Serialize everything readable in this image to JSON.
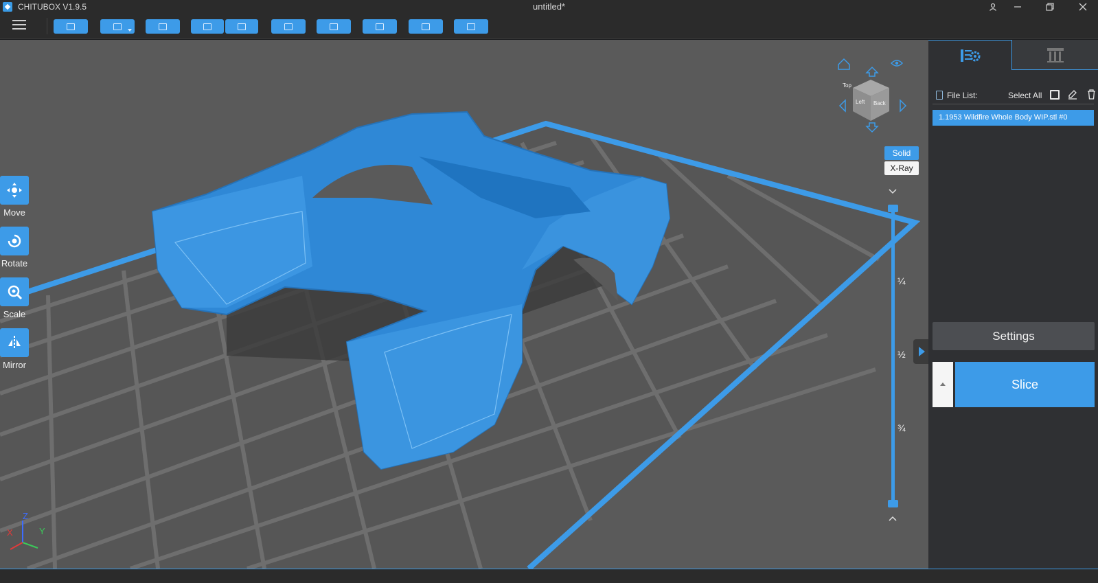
{
  "window": {
    "app_name": "CHITUBOX V1.9.5",
    "doc_title": "untitled*"
  },
  "toolbar": {
    "buttons": [
      "open-file",
      "save",
      "auto-layout",
      "undo",
      "redo",
      "hollow",
      "duplicate",
      "drain-hole",
      "mirror-settings",
      "print-settings"
    ]
  },
  "tools": {
    "move": "Move",
    "rotate": "Rotate",
    "scale": "Scale",
    "mirror": "Mirror"
  },
  "view_mode": {
    "solid": "Solid",
    "xray": "X-Ray",
    "active": "Solid"
  },
  "layer_slider": {
    "marks": [
      "¼",
      "½",
      "¾"
    ]
  },
  "axes": {
    "x": "X",
    "y": "Y",
    "z": "Z"
  },
  "view_cube": {
    "faces": [
      "Left",
      "Back",
      "Top"
    ]
  },
  "panel": {
    "file_list_label": "File List:",
    "select_all_label": "Select All",
    "files": [
      "1.1953 Wildfire Whole Body WIP.stl #0"
    ],
    "settings_label": "Settings",
    "slice_label": "Slice"
  },
  "colors": {
    "accent": "#3d9be8",
    "viewport": "#5a5a5a",
    "grid": "#6c6c6c",
    "model": "#2f88d6"
  }
}
